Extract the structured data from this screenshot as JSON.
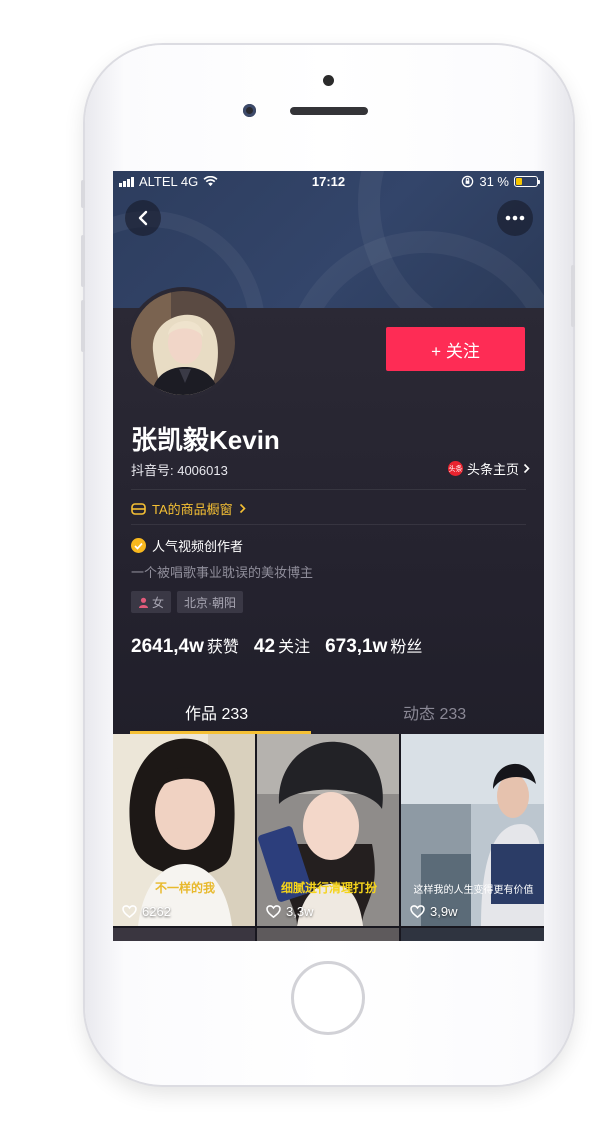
{
  "status_bar": {
    "carrier": "ALTEL 4G",
    "time": "17:12",
    "battery_text": "31 %",
    "battery_level": 0.31
  },
  "profile": {
    "name": "张凯毅Kevin",
    "douyin_id": "抖音号: 4006013",
    "toutiao_icon_text": "头条",
    "toutiao_link": "头条主页",
    "shop_window": "TA的商品橱窗",
    "verified_label": "人气视频创作者",
    "bio": "一个被唱歌事业耽误的美妆博主",
    "tags": [
      {
        "label": "女",
        "icon": "female-icon"
      },
      {
        "label": "北京·朝阳",
        "icon": ""
      }
    ],
    "stats": [
      {
        "value": "2641,4w",
        "label": "获赞"
      },
      {
        "value": "42",
        "label": "关注"
      },
      {
        "value": "673,1w",
        "label": "粉丝"
      }
    ]
  },
  "actions": {
    "follow_label": "+ 关注",
    "back_icon": "back-chevron-icon",
    "more_icon": "more-dots-icon"
  },
  "tabs": [
    {
      "label": "作品 233",
      "active": true
    },
    {
      "label": "动态 233",
      "active": false
    }
  ],
  "videos": [
    {
      "likes": "6262",
      "caption": "不一样的我",
      "caption_color": "#e8b92c"
    },
    {
      "likes": "3,3w",
      "caption": "细腻进行清理打扮",
      "caption_color": "#f4d31b"
    },
    {
      "likes": "3,9w",
      "caption": "这样我的人生变得更有价值",
      "caption_color": "#ffffff"
    }
  ],
  "colors": {
    "accent": "#fe2c55",
    "gold": "#f5c034",
    "panel": "#24222e"
  }
}
